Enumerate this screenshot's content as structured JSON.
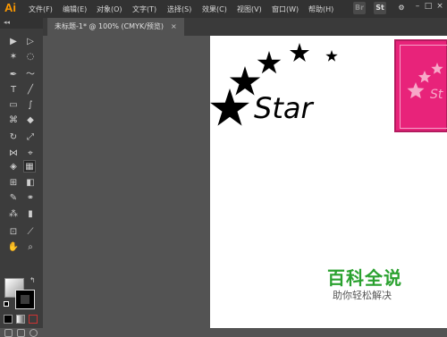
{
  "app": {
    "logo": "Ai",
    "menu": [
      "文件(F)",
      "编辑(E)",
      "对象(O)",
      "文字(T)",
      "选择(S)",
      "效果(C)",
      "视图(V)",
      "窗口(W)",
      "帮助(H)"
    ],
    "bridge_icon": "Br",
    "stock_icon": "St",
    "window_controls": [
      "minimize-icon",
      "maximize-icon",
      "close-icon"
    ]
  },
  "document": {
    "tab_title": "未标题-1* @ 100% (CMYK/预览)",
    "tab_close": "×"
  },
  "toolbar": {
    "collapse_glyph": "◂◂",
    "tools": [
      {
        "name": "selection-tool",
        "glyph": "▶"
      },
      {
        "name": "direct-selection-tool",
        "glyph": "▷"
      },
      {
        "name": "magic-wand-tool",
        "glyph": "✶"
      },
      {
        "name": "lasso-tool",
        "glyph": "◌"
      },
      {
        "name": "pen-tool",
        "glyph": "✒"
      },
      {
        "name": "curvature-tool",
        "glyph": "〜"
      },
      {
        "name": "type-tool",
        "glyph": "T"
      },
      {
        "name": "line-tool",
        "glyph": "╱"
      },
      {
        "name": "rectangle-tool",
        "glyph": "▭"
      },
      {
        "name": "paintbrush-tool",
        "glyph": "∫"
      },
      {
        "name": "shaper-tool",
        "glyph": "⌘"
      },
      {
        "name": "eraser-tool",
        "glyph": "◆"
      },
      {
        "name": "rotate-tool",
        "glyph": "↻"
      },
      {
        "name": "scale-tool",
        "glyph": "⤢"
      },
      {
        "name": "width-tool",
        "glyph": "⋈"
      },
      {
        "name": "free-transform-tool",
        "glyph": "⌖"
      },
      {
        "name": "shape-builder-tool",
        "glyph": "◈"
      },
      {
        "name": "perspective-grid-tool",
        "glyph": "▦"
      },
      {
        "name": "mesh-tool",
        "glyph": "⊞"
      },
      {
        "name": "gradient-tool",
        "glyph": "◧"
      },
      {
        "name": "eyedropper-tool",
        "glyph": "✎"
      },
      {
        "name": "blend-tool",
        "glyph": "⚭"
      },
      {
        "name": "symbol-sprayer-tool",
        "glyph": "⁂"
      },
      {
        "name": "column-graph-tool",
        "glyph": "▮"
      },
      {
        "name": "artboard-tool",
        "glyph": "⊡"
      },
      {
        "name": "slice-tool",
        "glyph": "⟋"
      },
      {
        "name": "hand-tool",
        "glyph": "✋"
      },
      {
        "name": "zoom-tool",
        "glyph": "⌕"
      }
    ],
    "swap_glyph": "↰"
  },
  "artwork": {
    "star_text": "Star",
    "pink_text": "St"
  },
  "watermark": {
    "title": "百科全说",
    "subtitle": "助你轻松解决"
  },
  "colors": {
    "menubar": "#323232",
    "toolbar": "#3c3c3c",
    "workspace": "#535353",
    "logo": "#ff9a00",
    "pink": "#e8237a",
    "watermark_green": "#2aa12f"
  }
}
